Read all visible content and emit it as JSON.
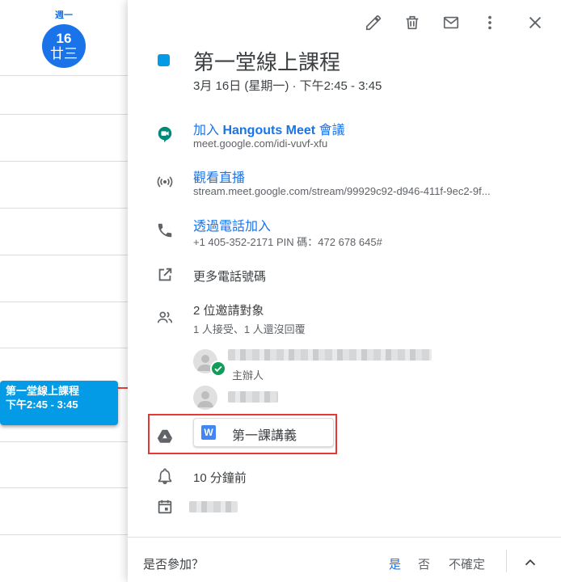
{
  "calendar": {
    "day_of_week": "週一",
    "date": "16",
    "lunar_date": "廿三",
    "event_chip": {
      "title": "第一堂線上課程",
      "time": "下午2:45 - 3:45"
    }
  },
  "colors": {
    "accent": "#1a73e8",
    "event": "#039be5",
    "accepted": "#0f9d58",
    "highlight": "#e53935"
  },
  "toolbar": {
    "edit_icon": "pencil-icon",
    "delete_icon": "trash-icon",
    "email_icon": "mail-icon",
    "more_icon": "more-vert-icon",
    "close_icon": "close-icon"
  },
  "event": {
    "title": "第一堂線上課程",
    "datetime": "3月 16日 (星期一)  ·  下午2:45 - 3:45"
  },
  "meet": {
    "join_prefix": "加入 ",
    "join_brand": "Hangouts Meet",
    "join_suffix": " 會議",
    "url": "meet.google.com/idi-vuvf-xfu"
  },
  "stream": {
    "label": "觀看直播",
    "url": "stream.meet.google.com/stream/99929c92-d946-411f-9ec2-9f..."
  },
  "phone": {
    "label": "透過電話加入",
    "number": "+1 405-352-2171 PIN 碼：472 678 645#"
  },
  "more_numbers": {
    "label": "更多電話號碼"
  },
  "guests": {
    "count_label": "2 位邀請對象",
    "summary": "1 人接受、1 人還沒回覆",
    "organizer_role": "主辦人"
  },
  "attachment": {
    "file_icon_letter": "W",
    "name": "第一課講義"
  },
  "reminder": {
    "label": "10 分鐘前"
  },
  "rsvp": {
    "question": "是否參加？",
    "yes": "是",
    "no": "否",
    "maybe": "不確定"
  }
}
